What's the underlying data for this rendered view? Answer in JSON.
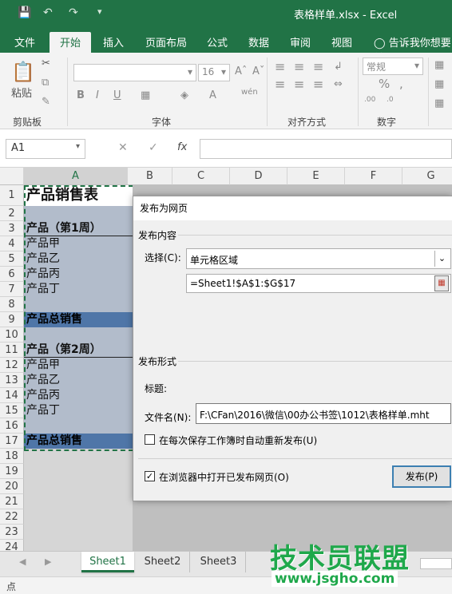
{
  "window": {
    "title": "表格样单.xlsx - Excel"
  },
  "tabs": [
    "文件",
    "开始",
    "插入",
    "页面布局",
    "公式",
    "数据",
    "审阅",
    "视图"
  ],
  "tellme": "告诉我你想要做",
  "ribbon": {
    "paste_label": "粘贴",
    "groups": {
      "clipboard": "剪贴板",
      "font": "字体",
      "align": "对齐方式",
      "number": "数字"
    },
    "font_size": "16",
    "number_format": "常规"
  },
  "formula_bar": {
    "name_box": "A1",
    "fx": "fx"
  },
  "columns": [
    "A",
    "B",
    "C",
    "D",
    "E",
    "F",
    "G"
  ],
  "rows": [
    "1",
    "2",
    "3",
    "4",
    "5",
    "6",
    "7",
    "8",
    "9",
    "10",
    "11",
    "12",
    "13",
    "14",
    "15",
    "16",
    "17",
    "18",
    "19",
    "20",
    "21",
    "22",
    "23",
    "24"
  ],
  "cells": {
    "r1": "产品销售表",
    "r3": "产品（第1周）",
    "r4": "产品甲",
    "r5": "产品乙",
    "r6": "产品丙",
    "r7": "产品丁",
    "r9": "产品总销售",
    "r11": "产品（第2周）",
    "r12": "产品甲",
    "r13": "产品乙",
    "r14": "产品丙",
    "r15": "产品丁",
    "r17": "产品总销售"
  },
  "dialog": {
    "title": "发布为网页",
    "section_content": "发布内容",
    "select_label": "选择(C):",
    "select_value": "单元格区域",
    "range_value": "=Sheet1!$A$1:$G$17",
    "section_format": "发布形式",
    "title_label": "标题:",
    "filename_label": "文件名(N):",
    "filename_value": "F:\\CFan\\2016\\微信\\00办公书签\\1012\\表格样单.mht",
    "autorepublish_label": "在每次保存工作簿时自动重新发布(U)",
    "autorepublish_checked": false,
    "open_browser_label": "在浏览器中打开已发布网页(O)",
    "open_browser_checked": true,
    "publish_button": "发布(P)"
  },
  "sheets": [
    "Sheet1",
    "Sheet2",
    "Sheet3"
  ],
  "active_sheet": "Sheet1",
  "status": {
    "mode": "点"
  },
  "watermark": {
    "text": "技术员联盟",
    "url": "www.jsgho.com"
  },
  "colors": {
    "excel_green": "#217346",
    "selected_cell": "#b2bccb",
    "header_cell": "#4f76a8"
  }
}
